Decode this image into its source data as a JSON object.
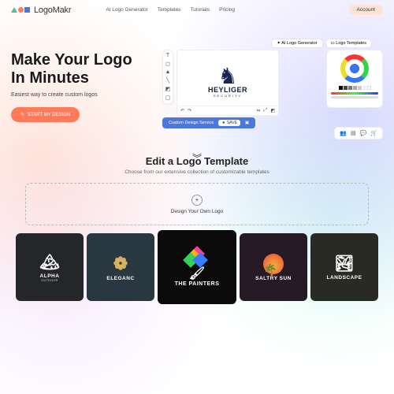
{
  "header": {
    "brand": "LogoMakr",
    "nav": [
      "AI Logo Generator",
      "Templates",
      "Tutorials",
      "Pricing"
    ],
    "account_label": "Account"
  },
  "hero": {
    "title_l1": "Make Your Logo",
    "title_l2": "In Minutes",
    "subtitle": "Easiest way to create custom logos",
    "start_label": "START MY DESIGN",
    "app_tabs": {
      "ai": "AI Logo Generator",
      "templates": "Logo Templates"
    },
    "canvas_logo": {
      "name": "HEYLIGER",
      "tag": "SECURITY"
    },
    "bottom_bar": {
      "cds": "Custom Design Service",
      "save": "SAVE"
    }
  },
  "templates": {
    "heading": "Edit a Logo Template",
    "sub": "Choose from our extensive collection of customizable templates",
    "design_own": "Design Your Own Logo",
    "cards": {
      "alpha": {
        "name": "ALPHA",
        "sub": "OUTDOOR"
      },
      "eleg": {
        "name": "ELEGANC"
      },
      "painters": {
        "name": "THE PAINTERS"
      },
      "saltry": {
        "name": "SALTRY SUN"
      },
      "land": {
        "name": "LANDSCAPE"
      }
    }
  }
}
